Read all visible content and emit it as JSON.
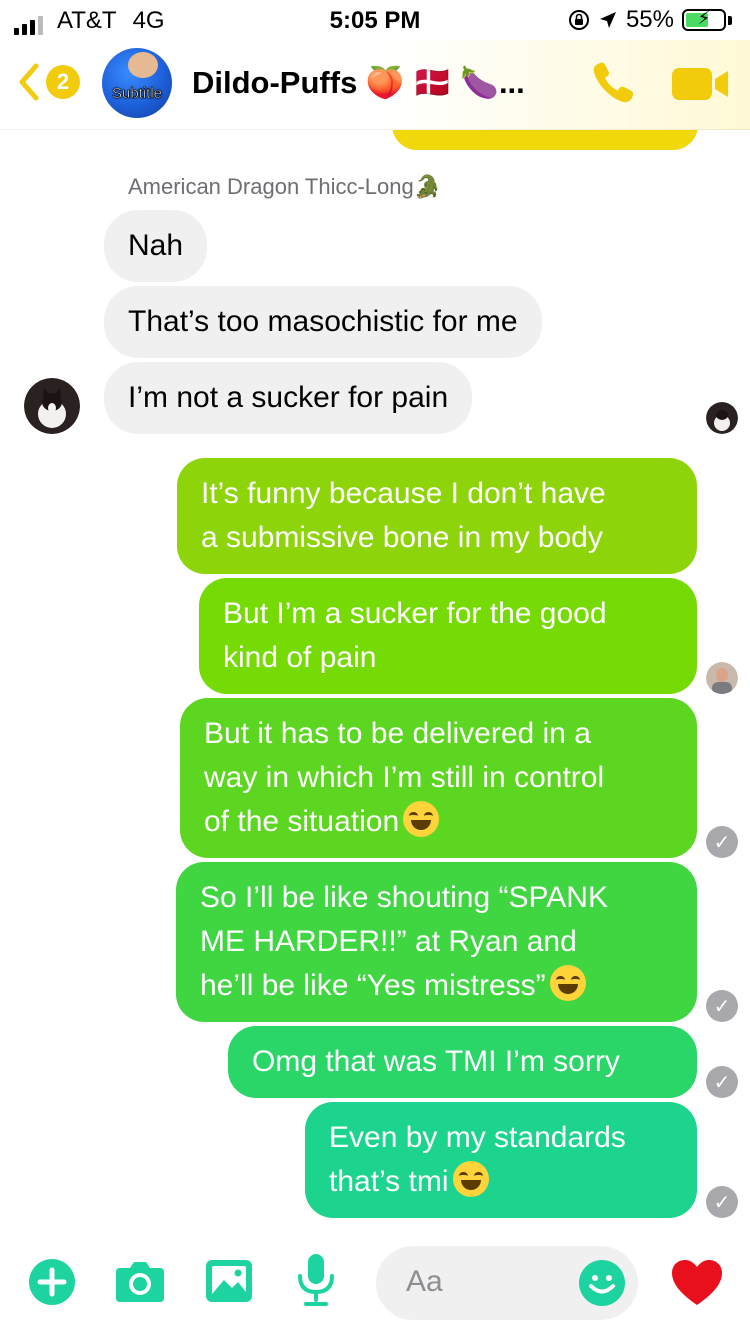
{
  "status_bar": {
    "carrier": "AT&T",
    "network": "4G",
    "time": "5:05 PM",
    "battery_percent": "55%",
    "battery_level": 0.55
  },
  "header": {
    "back_badge_count": "2",
    "avatar_caption": "Subtitle",
    "title": "Dildo-Puffs 🍑 🇩🇰 🍆...",
    "accent_color": "#f2cc0c"
  },
  "messages": {
    "sender_name": "American Dragon Thicc-Long🐊",
    "incoming": [
      {
        "text": "Nah"
      },
      {
        "text": "That’s too masochistic for me"
      },
      {
        "text": "I’m not a sucker for pain"
      }
    ],
    "outgoing": [
      {
        "line1": "It’s funny because I don’t have",
        "line2": "a submissive bone in my body"
      },
      {
        "line1": "But I’m a sucker for the good",
        "line2": "kind of pain"
      },
      {
        "line1": "But it has to be delivered in a",
        "line2": "way in which I’m still in control",
        "line3": "of the situation"
      },
      {
        "line1": "So I’ll be like shouting “SPANK",
        "line2": "ME HARDER!!” at Ryan and",
        "line3": "he’ll be like “Yes mistress”"
      },
      {
        "line1": "Omg that was TMI I’m sorry"
      },
      {
        "line1": "Even by my standards",
        "line2": "that’s tmi"
      }
    ],
    "seen_check": "✓"
  },
  "composer": {
    "placeholder": "Aa"
  },
  "icons": {
    "back": "chevron-left-icon",
    "call": "phone-icon",
    "video": "video-camera-icon",
    "add": "plus-circle-icon",
    "camera": "camera-icon",
    "gallery": "image-icon",
    "mic": "microphone-icon",
    "emoji": "smiley-icon",
    "like": "heart-icon"
  }
}
